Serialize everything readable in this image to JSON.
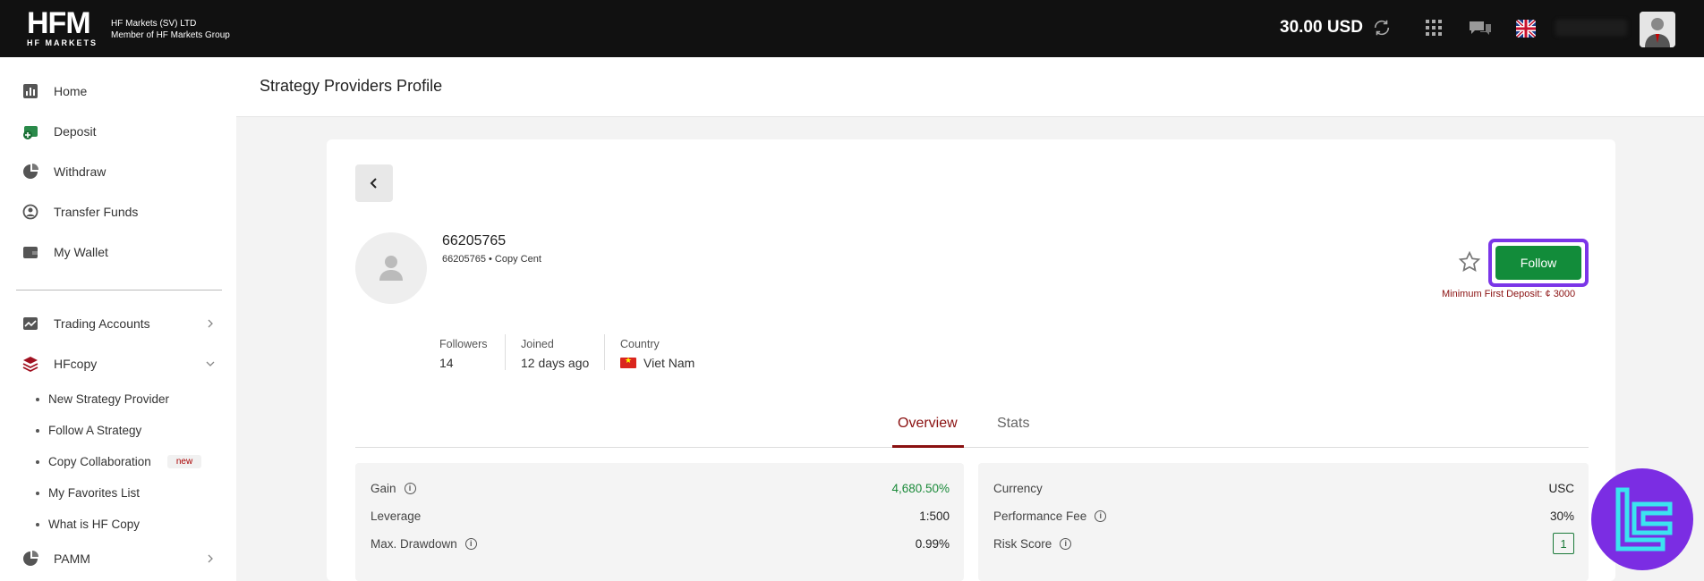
{
  "header": {
    "brand": "HFM",
    "brand_sub": "HF MARKETS",
    "entity_line1": "HF Markets (SV) LTD",
    "entity_line2": "Member of HF Markets Group",
    "balance": "30.00 USD",
    "icons": [
      "refresh-icon",
      "apps-grid-icon",
      "chat-icon",
      "uk-flag-icon",
      "user-avatar"
    ]
  },
  "sidebar": {
    "items": [
      {
        "label": "Home",
        "icon": "bar-chart-icon"
      },
      {
        "label": "Deposit",
        "icon": "deposit-icon"
      },
      {
        "label": "Withdraw",
        "icon": "pie-chart-icon"
      },
      {
        "label": "Transfer Funds",
        "icon": "transfer-icon"
      },
      {
        "label": "My Wallet",
        "icon": "wallet-icon"
      },
      {
        "label": "Trading Accounts",
        "icon": "trend-icon"
      },
      {
        "label": "HFcopy",
        "icon": "layers-icon"
      },
      {
        "label": "PAMM",
        "icon": "pie-icon"
      }
    ],
    "hfcopy_sub": [
      {
        "label": "New Strategy Provider"
      },
      {
        "label": "Follow A Strategy"
      },
      {
        "label": "Copy Collaboration",
        "badge": "new"
      },
      {
        "label": "My Favorites List"
      },
      {
        "label": "What is HF Copy"
      }
    ]
  },
  "page": {
    "title": "Strategy Providers Profile"
  },
  "profile": {
    "name": "66205765",
    "subtitle": "66205765 • Copy Cent",
    "follow_label": "Follow",
    "min_deposit": "Minimum First Deposit: ¢ 3000",
    "stats": {
      "followers_label": "Followers",
      "followers_value": "14",
      "joined_label": "Joined",
      "joined_value": "12 days ago",
      "country_label": "Country",
      "country_value": "Viet Nam"
    }
  },
  "tabs": [
    {
      "label": "Overview",
      "active": true
    },
    {
      "label": "Stats",
      "active": false
    }
  ],
  "overview_left": [
    {
      "label": "Gain",
      "value": "4,680.50%",
      "info": true
    },
    {
      "label": "Leverage",
      "value": "1:500",
      "info": false
    },
    {
      "label": "Max. Drawdown",
      "value": "0.99%",
      "info": true
    }
  ],
  "overview_right": [
    {
      "label": "Currency",
      "value": "USC",
      "info": false
    },
    {
      "label": "Performance Fee",
      "value": "30%",
      "info": true
    },
    {
      "label": "Risk Score",
      "value": "1",
      "info": true
    }
  ],
  "colors": {
    "accent": "#8a1010",
    "follow": "#128c3a",
    "highlight": "#7b35e8",
    "gain": "#1b8a3a"
  }
}
